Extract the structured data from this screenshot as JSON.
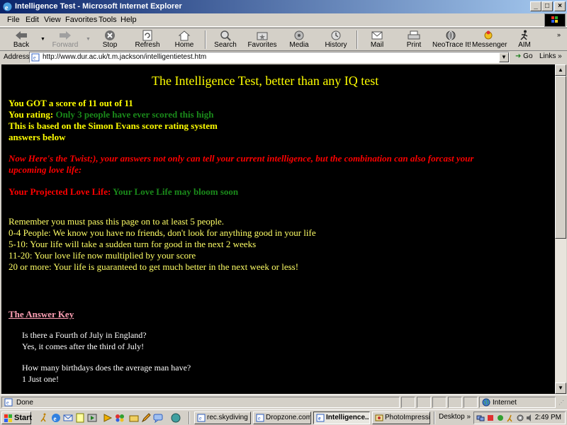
{
  "window": {
    "title": "Intelligence Test - Microsoft Internet Explorer",
    "controls": {
      "minimize": "_",
      "maximize": "□",
      "close": "×"
    }
  },
  "menu": [
    "File",
    "Edit",
    "View",
    "Favorites",
    "Tools",
    "Help"
  ],
  "toolbar": {
    "back": "Back",
    "forward": "Forward",
    "stop": "Stop",
    "refresh": "Refresh",
    "home": "Home",
    "search": "Search",
    "favorites": "Favorites",
    "media": "Media",
    "history": "History",
    "mail": "Mail",
    "print": "Print",
    "neotrace": "NeoTrace It!",
    "messenger": "Messenger",
    "aim": "AIM"
  },
  "address": {
    "label": "Address",
    "url": "http://www.dur.ac.uk/t.m.jackson/intelligentietest.htm",
    "go": "Go",
    "links": "Links"
  },
  "content": {
    "heading": "The Intelligence Test, better than any IQ test",
    "score": "You GOT a score of 11 out of 11",
    "rating_label": "You rating:",
    "rating_value": "Only 3 people have ever scored this high",
    "based_on": "This is based on the Simon Evans score rating system",
    "answers_below": "answers below",
    "twist_line1": "Now Here's the Twist;), your answers not only can tell your current intelligence, but the combination can also forcast your",
    "twist_line2": "upcoming love life:",
    "love_label": "Your Projected Love Life:",
    "love_value": "Your Love Life may bloom soon",
    "remember": "Remember you must pass this page on to at least 5 people.",
    "rules": [
      "0-4 People: We know you have no friends, don't look for anything good in your life",
      "5-10: Your life will take a sudden turn for good in the next 2 weeks",
      "11-20: Your love life now multiplied by your score",
      "20 or more: Your life is guaranteed to get much better in the next week or less!"
    ],
    "answer_key_link": "The Answer Key",
    "qa": [
      {
        "q": "Is there a Fourth of July in England?",
        "a": "Yes, it comes after the third of July!"
      },
      {
        "q": "How many birthdays does the average man have?",
        "a": "1 Just one!"
      }
    ]
  },
  "status": {
    "text": "Done",
    "zone": "Internet"
  },
  "taskbar": {
    "start": "Start",
    "tasks": [
      {
        "label": "rec.skydiving - ...",
        "active": false
      },
      {
        "label": "Dropzone.com...",
        "active": false
      },
      {
        "label": "Intelligence...",
        "active": true
      },
      {
        "label": "PhotoImpression",
        "active": false
      }
    ],
    "desktop": "Desktop",
    "clock": "2:49 PM"
  },
  "colors": {
    "page_bg": "#000000",
    "heading": "#ffff00",
    "green": "#1a8a1a",
    "red": "#ff0000",
    "link": "#ffa0b4"
  }
}
